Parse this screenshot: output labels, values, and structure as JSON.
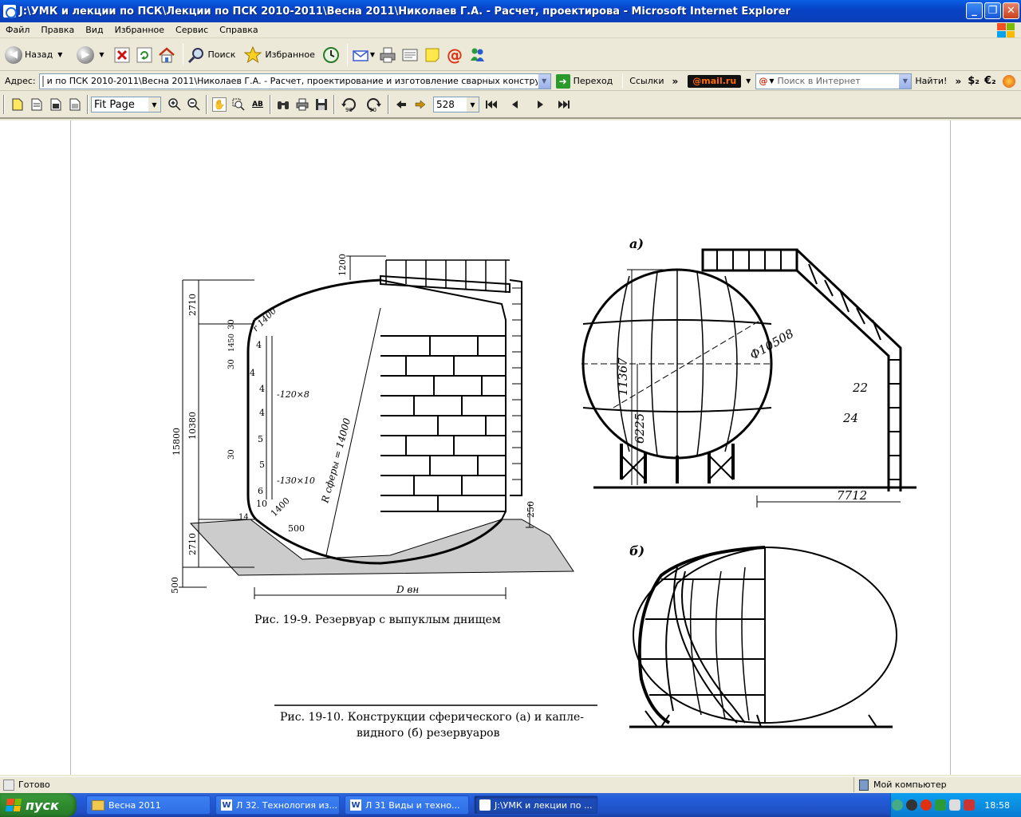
{
  "window": {
    "title": "J:\\УМК и лекции  по ПСК\\Лекции по ПСК  2010-2011\\Весна 2011\\Николаев Г.А. - Расчет, проектирова - Microsoft Internet Explorer",
    "min": "_",
    "max": "❐",
    "close": "✕"
  },
  "menu": [
    "Файл",
    "Правка",
    "Вид",
    "Избранное",
    "Сервис",
    "Справка"
  ],
  "toolbar": {
    "back": "Назад",
    "search": "Поиск",
    "favorites": "Избранное"
  },
  "address": {
    "label": "Адрес:",
    "value": "и по ПСК  2010-2011\\Весна 2011\\Николаев Г.А. - Расчет, проектирование и изготовление сварных конструкций.djvu",
    "go": "Переход",
    "links": "Ссылки",
    "mail_brand": "@mail.ru",
    "search_placeholder": "Поиск в Интернет",
    "find": "Найти!",
    "chev": "»"
  },
  "djvu": {
    "zoom": "Fit Page",
    "page": "528"
  },
  "figures": {
    "fig9_caption": "Рис. 19-9. Резервуар с выпуклым днищем",
    "fig10_caption_1": "Рис. 19-10. Конструкции сферического (а) и капле-",
    "fig10_caption_2": "видного (б) резервуаров",
    "label_a": "а)",
    "label_b": "б)",
    "dims": {
      "d1200": "1200",
      "d2710_top": "2710",
      "d15800": "15800",
      "d10380": "10380",
      "d2710_bot": "2710",
      "d500": "500",
      "r1400_top": "r 1400",
      "r1400_bot": "1400",
      "plate1": "-120×8",
      "plate2": "-130×10",
      "rsphere": "R сферы = 14000",
      "d500b": "500",
      "d250": "250",
      "dvn": "D вн",
      "phi": "Ф10508",
      "h11367": "11367",
      "h6225": "6225",
      "w7712": "7712",
      "t22": "22",
      "t24": "24",
      "s30a": "30",
      "s30b": "30",
      "s30c": "30",
      "s1450": "1450",
      "n4a": "4",
      "n4b": "4",
      "n4c": "4",
      "n4d": "4",
      "n5a": "5",
      "n5b": "5",
      "n6": "6",
      "n10": "10",
      "n14": "14"
    }
  },
  "status": {
    "text": "Готово",
    "zone": "Мой компьютер"
  },
  "taskbar": {
    "start": "пуск",
    "tasks": [
      "Весна 2011",
      "Л 32. Технология из...",
      "Л 31  Виды и техно...",
      "J:\\УМК и лекции  по ..."
    ],
    "clock": "18:58"
  },
  "colors": {
    "xp_blue": "#0A5FE6",
    "start_green": "#2e8b2e",
    "chrome": "#ECE9D8"
  }
}
